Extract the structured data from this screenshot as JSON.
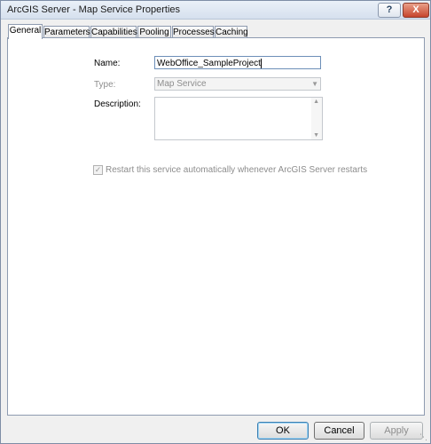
{
  "window": {
    "title": "ArcGIS Server - Map Service Properties",
    "help_label": "?",
    "close_label": "X"
  },
  "tabs": [
    {
      "label": "General",
      "active": true
    },
    {
      "label": "Parameters",
      "active": false
    },
    {
      "label": "Capabilities",
      "active": false
    },
    {
      "label": "Pooling",
      "active": false
    },
    {
      "label": "Processes",
      "active": false
    },
    {
      "label": "Caching",
      "active": false
    }
  ],
  "general": {
    "name_label": "Name:",
    "name_value": "WebOffice_SampleProject",
    "type_label": "Type:",
    "type_value": "Map Service",
    "description_label": "Description:",
    "description_value": "",
    "restart_label": "Restart this service automatically whenever ArcGIS Server restarts",
    "restart_checked": true
  },
  "buttons": {
    "ok": "OK",
    "cancel": "Cancel",
    "apply": "Apply"
  }
}
